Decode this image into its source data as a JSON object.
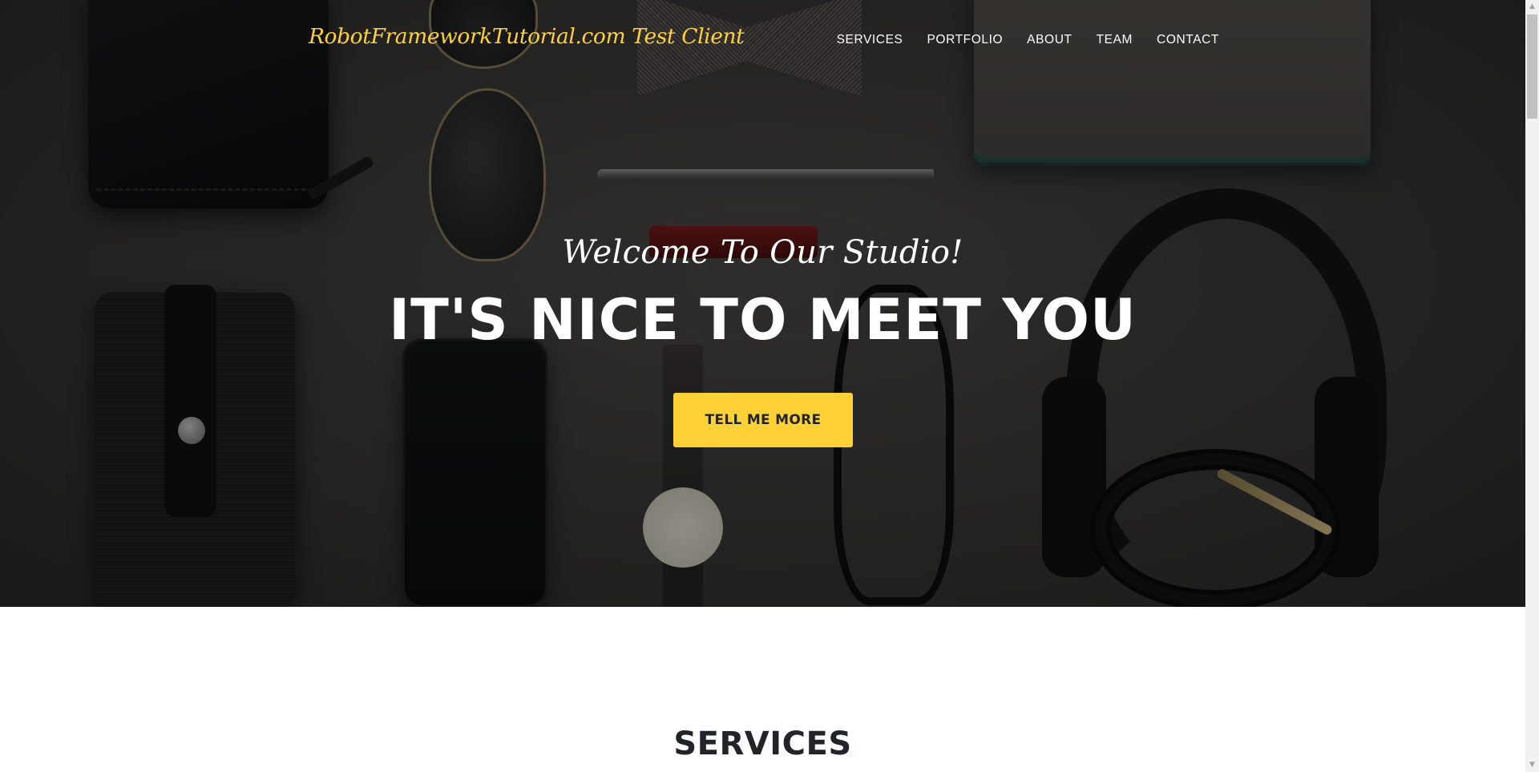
{
  "navbar": {
    "brand": "RobotFrameworkTutorial.com Test Client",
    "items": [
      {
        "label": "SERVICES"
      },
      {
        "label": "PORTFOLIO"
      },
      {
        "label": "ABOUT"
      },
      {
        "label": "TEAM"
      },
      {
        "label": "CONTACT"
      }
    ]
  },
  "hero": {
    "subheading": "Welcome To Our Studio!",
    "heading": "IT'S NICE TO MEET YOU",
    "button_label": "TELL ME MORE"
  },
  "services": {
    "heading": "SERVICES"
  },
  "colors": {
    "accent": "#fed136",
    "text_dark": "#212529",
    "nav_text": "#ffffff"
  },
  "icons": {
    "scroll_up": "scroll-up-arrow-icon",
    "scroll_down": "scroll-down-arrow-icon"
  }
}
